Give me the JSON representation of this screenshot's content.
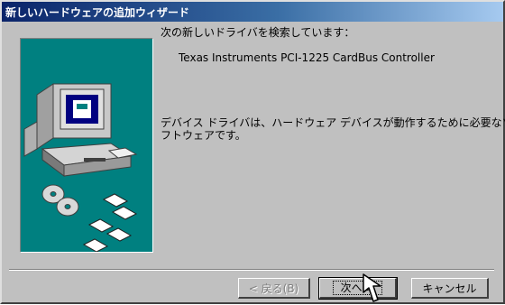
{
  "window": {
    "title": "新しいハードウェアの追加ウィザード"
  },
  "content": {
    "searching": "次の新しいドライバを検索しています：",
    "device_name": "Texas Instruments PCI-1225 CardBus Controller",
    "description_line1": "デバイス ドライバは、ハードウェア デバイスが動作するために必要なソ",
    "description_line2": "フトウェアです。"
  },
  "buttons": {
    "back": "< 戻る(B)",
    "next": "次へ >",
    "cancel": "キャンセル"
  },
  "colors": {
    "title_gradient_start": "#0a246a",
    "title_gradient_end": "#a6caf0",
    "dialog_face": "#c0c0c0",
    "art_background": "#008080"
  },
  "icons": [
    "computer-illustration",
    "cd-disc-icon",
    "floppy-disk-icon",
    "mouse-cursor-icon"
  ]
}
